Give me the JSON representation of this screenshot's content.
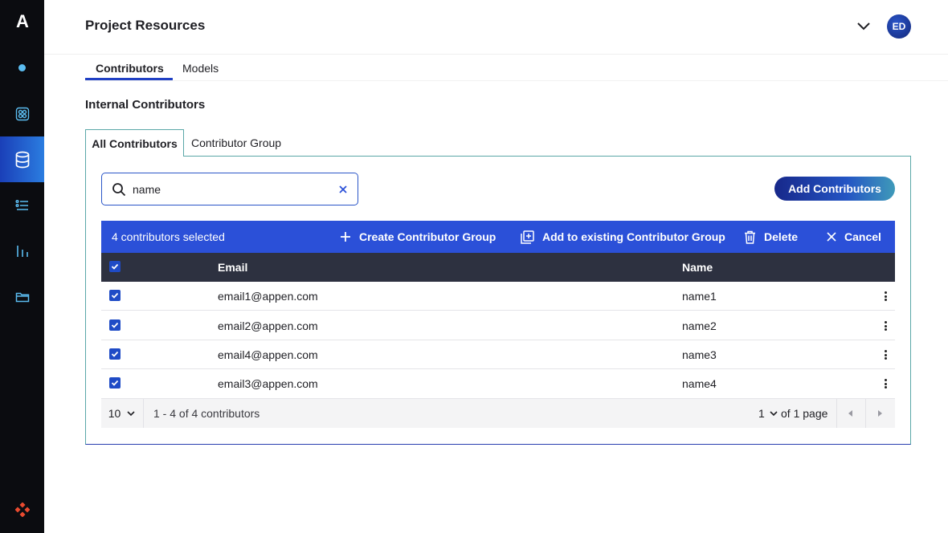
{
  "rail": {
    "logo": "A",
    "items": [
      "status-dot",
      "dashboard-icon",
      "database-icon",
      "list-icon",
      "bar-chart-icon",
      "folder-icon"
    ],
    "active": "database-icon",
    "bottom_icon": "diamond-logo-icon"
  },
  "header": {
    "title": "Project Resources",
    "avatar_initials": "ED"
  },
  "tabs": [
    {
      "label": "Contributors",
      "active": true
    },
    {
      "label": "Models",
      "active": false
    }
  ],
  "section_title": "Internal Contributors",
  "subtabs": [
    {
      "label": "All Contributors",
      "active": true
    },
    {
      "label": "Contributor Group",
      "active": false
    }
  ],
  "search": {
    "value": "name",
    "placeholder": ""
  },
  "add_button": "Add Contributors",
  "selection_bar": {
    "count_label": "4 contributors selected",
    "create_group": "Create Contributor Group",
    "add_existing": "Add to existing Contributor Group",
    "delete": "Delete",
    "cancel": "Cancel"
  },
  "table": {
    "headers": {
      "email": "Email",
      "name": "Name"
    },
    "rows": [
      {
        "email": "email1@appen.com",
        "name": "name1",
        "checked": true
      },
      {
        "email": "email2@appen.com",
        "name": "name2",
        "checked": true
      },
      {
        "email": "email4@appen.com",
        "name": "name3",
        "checked": true
      },
      {
        "email": "email3@appen.com",
        "name": "name4",
        "checked": true
      }
    ]
  },
  "pagination": {
    "page_size": "10",
    "range": "1 - 4 of 4 contributors",
    "current_page": "1",
    "of_pages": "of 1 page"
  },
  "colors": {
    "accent": "#2b50d8",
    "header_dark": "#2d3140",
    "rail": "#0b0c10",
    "teal_border": "#5aa7a8"
  }
}
